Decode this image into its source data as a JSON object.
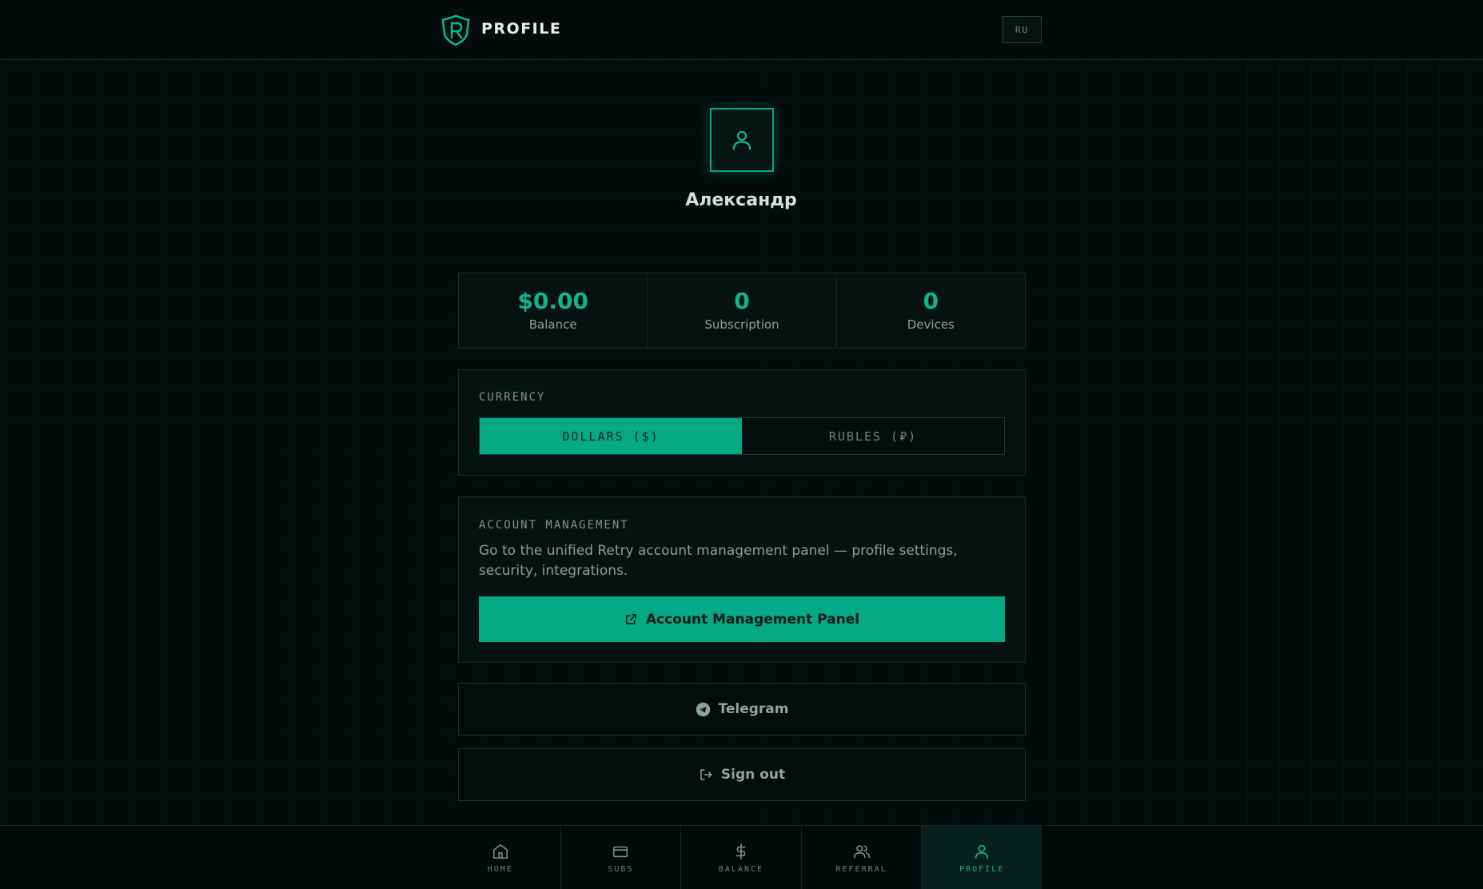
{
  "header": {
    "title": "PROFILE",
    "lang_button": "RU"
  },
  "profile": {
    "name": "Александр"
  },
  "stats": [
    {
      "value": "$0.00",
      "label": "Balance"
    },
    {
      "value": "0",
      "label": "Subscription"
    },
    {
      "value": "0",
      "label": "Devices"
    }
  ],
  "currency": {
    "title": "CURRENCY",
    "options": [
      {
        "label": "DOLLARS ($)",
        "active": true
      },
      {
        "label": "RUBLES (₽)",
        "active": false
      }
    ]
  },
  "account": {
    "title": "ACCOUNT MANAGEMENT",
    "description": "Go to the unified Retry account management panel — profile settings, security, integrations.",
    "button_label": "Account Management Panel"
  },
  "links": {
    "telegram_label": "Telegram",
    "signout_label": "Sign out"
  },
  "nav": [
    {
      "label": "HOME",
      "icon": "home-icon",
      "active": false
    },
    {
      "label": "SUBS",
      "icon": "card-icon",
      "active": false
    },
    {
      "label": "BALANCE",
      "icon": "dollar-icon",
      "active": false
    },
    {
      "label": "REFERRAL",
      "icon": "users-icon",
      "active": false
    },
    {
      "label": "PROFILE",
      "icon": "user-icon",
      "active": true
    }
  ],
  "colors": {
    "accent": "#05a983",
    "background": "#030c0b",
    "card": "#061210"
  }
}
